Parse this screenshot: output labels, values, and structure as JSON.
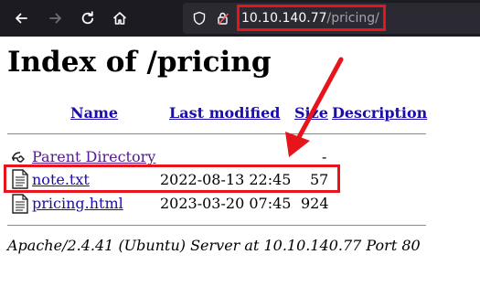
{
  "browser": {
    "url_host": "10.10.140.77",
    "url_path": "/pricing/",
    "icons": [
      "back-icon",
      "forward-icon",
      "reload-icon",
      "home-icon",
      "shield-icon",
      "lock-warning-icon"
    ]
  },
  "page": {
    "title": "Index of /pricing",
    "columns": {
      "name": "Name",
      "last_modified": "Last modified",
      "size": "Size",
      "description": "Description"
    },
    "rows": [
      {
        "name": "Parent Directory",
        "last_modified": "",
        "size": "-",
        "icon": "back-folder-icon"
      },
      {
        "name": "note.txt",
        "last_modified": "2022-08-13 22:45",
        "size": "57",
        "icon": "text-file-icon"
      },
      {
        "name": "pricing.html",
        "last_modified": "2023-03-20 07:45",
        "size": "924",
        "icon": "text-file-icon"
      }
    ],
    "footer": "Apache/2.4.41 (Ubuntu) Server at 10.10.140.77 Port 80"
  },
  "colors": {
    "toolbar_bg": "#1c1b22",
    "urlbar_bg": "#2b2a33",
    "link": "#1a0dab",
    "visited_link": "#551a8b",
    "annotation_red": "#e8141b"
  }
}
